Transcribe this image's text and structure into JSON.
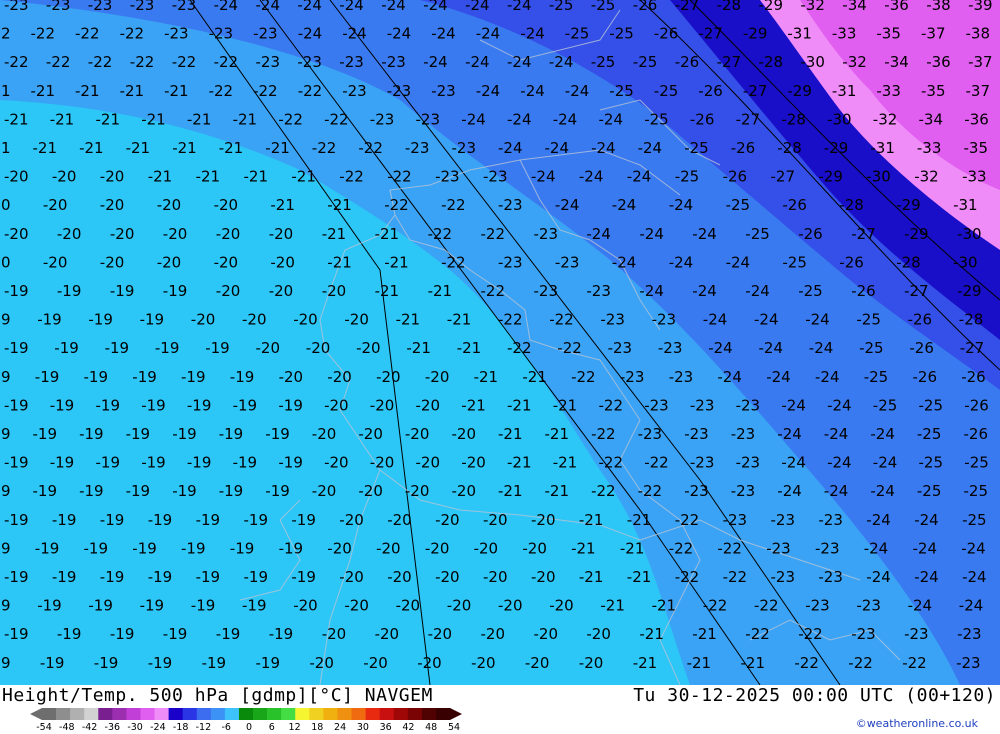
{
  "header": {
    "product_title": "Height/Temp. 500 hPa [gdmp][°C] NAVGEM",
    "valid_time": "Tu 30-12-2025 00:00 UTC (00+120)"
  },
  "legend": {
    "ticks": [
      "-54",
      "-48",
      "-42",
      "-36",
      "-30",
      "-24",
      "-18",
      "-12",
      "-6",
      "0",
      "6",
      "12",
      "18",
      "24",
      "30",
      "36",
      "42",
      "48",
      "54"
    ],
    "colors": [
      "#6e6e6e",
      "#8e8e8e",
      "#b0b0b0",
      "#d2d2d2",
      "#7a1f8f",
      "#9b2fb0",
      "#c13fd6",
      "#e05ff0",
      "#f08cf7",
      "#1a00c8",
      "#2a35e6",
      "#3c6cf0",
      "#3d93f5",
      "#3ec2fb",
      "#0a8a0a",
      "#19a619",
      "#2ac22a",
      "#44dd44",
      "#f5f532",
      "#f0d020",
      "#f0b010",
      "#f09010",
      "#f06a10",
      "#e82a10",
      "#c81010",
      "#a00808",
      "#7a0404",
      "#500202",
      "#380000"
    ]
  },
  "map": {
    "temperature_bands": [
      {
        "value": "-19",
        "color": "#2cc6f7"
      },
      {
        "value": "-20",
        "color": "#2cc6f7"
      },
      {
        "value": "-21",
        "color": "#3aa3f5"
      },
      {
        "value": "-22",
        "color": "#3aa3f5"
      },
      {
        "value": "-23",
        "color": "#3a7af0"
      },
      {
        "value": "-24",
        "color": "#3a7af0"
      },
      {
        "value": "-25",
        "color": "#3450e8"
      },
      {
        "value": "-26",
        "color": "#3450e8"
      },
      {
        "value": "-27",
        "color": "#1a0fc8"
      },
      {
        "value": "-28",
        "color": "#1a0fc8"
      },
      {
        "value": "-29",
        "color": "#1a0fc8"
      },
      {
        "value": "-30",
        "color": "#f08cf7"
      },
      {
        "value": "-31",
        "color": "#f08cf7"
      },
      {
        "value": "-32",
        "color": "#f08cf7"
      },
      {
        "value": "-33",
        "color": "#e05ff0"
      },
      {
        "value": "-34",
        "color": "#e05ff0"
      },
      {
        "value": "-35",
        "color": "#e05ff0"
      },
      {
        "value": "-36",
        "color": "#e05ff0"
      },
      {
        "value": "-37",
        "color": "#e05ff0"
      },
      {
        "value": "-38",
        "color": "#e05ff0"
      },
      {
        "value": "-39",
        "color": "#e05ff0"
      }
    ],
    "contour_labels": {
      "row_a": [
        "-23",
        "-23",
        "-23",
        "-23",
        "-23",
        "-24",
        "-24",
        "-24",
        "-24",
        "-24",
        "-24",
        "-24",
        "-24",
        "-25",
        "-25",
        "-26",
        "-27",
        "-28",
        "-29",
        "-32",
        "-34",
        "-36",
        "-38",
        "-39"
      ],
      "row_b": [
        "-22",
        "-22",
        "-22",
        "-22",
        "-23",
        "-23",
        "-23",
        "-24",
        "-24",
        "-24",
        "-24",
        "-24",
        "-24",
        "-25",
        "-25",
        "-26",
        "-27",
        "-29",
        "-31",
        "-33",
        "-35",
        "-37",
        "-38"
      ],
      "row_c": [
        "-22",
        "-22",
        "-22",
        "-22",
        "-22",
        "-22",
        "-23",
        "-23",
        "-23",
        "-23",
        "-24",
        "-24",
        "-24",
        "-24",
        "-25",
        "-25",
        "-26",
        "-27",
        "-28",
        "-30",
        "-32",
        "-34",
        "-36",
        "-37"
      ],
      "row_d": [
        "-21",
        "-21",
        "-21",
        "-21",
        "-21",
        "-22",
        "-22",
        "-22",
        "-23",
        "-23",
        "-23",
        "-24",
        "-24",
        "-24",
        "-25",
        "-25",
        "-26",
        "-27",
        "-29",
        "-31",
        "-33",
        "-35",
        "-37"
      ],
      "row_e": [
        "-21",
        "-21",
        "-21",
        "-21",
        "-21",
        "-21",
        "-22",
        "-22",
        "-23",
        "-23",
        "-24",
        "-24",
        "-24",
        "-24",
        "-25",
        "-26",
        "-27",
        "-28",
        "-30",
        "-32",
        "-34",
        "-36"
      ],
      "row_f": [
        "-21",
        "-21",
        "-21",
        "-21",
        "-21",
        "-21",
        "-21",
        "-22",
        "-22",
        "-23",
        "-23",
        "-24",
        "-24",
        "-24",
        "-24",
        "-25",
        "-26",
        "-28",
        "-29",
        "-31",
        "-33",
        "-35"
      ],
      "row_g": [
        "-20",
        "-20",
        "-20",
        "-21",
        "-21",
        "-21",
        "-21",
        "-22",
        "-22",
        "-23",
        "-23",
        "-24",
        "-24",
        "-24",
        "-25",
        "-26",
        "-27",
        "-29",
        "-30",
        "-32",
        "-33"
      ],
      "row_h": [
        "-20",
        "-20",
        "-20",
        "-20",
        "-20",
        "-21",
        "-21",
        "-22",
        "-22",
        "-23",
        "-24",
        "-24",
        "-24",
        "-25",
        "-26",
        "-28",
        "-29",
        "-31"
      ],
      "row_i": [
        "-20",
        "-20",
        "-20",
        "-20",
        "-20",
        "-20",
        "-21",
        "-21",
        "-22",
        "-22",
        "-23",
        "-24",
        "-24",
        "-24",
        "-25",
        "-26",
        "-27",
        "-29",
        "-30"
      ],
      "row_j": [
        "-20",
        "-20",
        "-20",
        "-20",
        "-20",
        "-20",
        "-21",
        "-21",
        "-22",
        "-23",
        "-23",
        "-24",
        "-24",
        "-24",
        "-25",
        "-26",
        "-28",
        "-30"
      ],
      "row_k": [
        "-19",
        "-19",
        "-19",
        "-19",
        "-20",
        "-20",
        "-20",
        "-21",
        "-21",
        "-22",
        "-23",
        "-23",
        "-24",
        "-24",
        "-24",
        "-25",
        "-26",
        "-27",
        "-29"
      ],
      "row_l": [
        "-19",
        "-19",
        "-19",
        "-19",
        "-20",
        "-20",
        "-20",
        "-20",
        "-21",
        "-21",
        "-22",
        "-22",
        "-23",
        "-23",
        "-24",
        "-24",
        "-24",
        "-25",
        "-26",
        "-28"
      ],
      "row_m": [
        "-19",
        "-19",
        "-19",
        "-19",
        "-19",
        "-20",
        "-20",
        "-20",
        "-21",
        "-21",
        "-22",
        "-22",
        "-23",
        "-23",
        "-24",
        "-24",
        "-24",
        "-25",
        "-26",
        "-27"
      ],
      "row_n": [
        "-19",
        "-19",
        "-19",
        "-19",
        "-19",
        "-19",
        "-20",
        "-20",
        "-20",
        "-20",
        "-21",
        "-21",
        "-22",
        "-23",
        "-23",
        "-24",
        "-24",
        "-24",
        "-25",
        "-26",
        "-26"
      ],
      "row_o": [
        "-19",
        "-19",
        "-19",
        "-19",
        "-19",
        "-19",
        "-19",
        "-20",
        "-20",
        "-20",
        "-21",
        "-21",
        "-21",
        "-22",
        "-23",
        "-23",
        "-23",
        "-24",
        "-24",
        "-25",
        "-25",
        "-26"
      ],
      "row_p": [
        "-19",
        "-19",
        "-19",
        "-19",
        "-19",
        "-19",
        "-19",
        "-20",
        "-20",
        "-20",
        "-20",
        "-21",
        "-21",
        "-22",
        "-23",
        "-23",
        "-23",
        "-24",
        "-24",
        "-24",
        "-25",
        "-26"
      ],
      "row_q": [
        "-19",
        "-19",
        "-19",
        "-19",
        "-19",
        "-19",
        "-19",
        "-20",
        "-20",
        "-20",
        "-20",
        "-21",
        "-21",
        "-22",
        "-22",
        "-23",
        "-23",
        "-24",
        "-24",
        "-24",
        "-25",
        "-25"
      ],
      "row_r": [
        "-19",
        "-19",
        "-19",
        "-19",
        "-19",
        "-19",
        "-19",
        "-20",
        "-20",
        "-20",
        "-20",
        "-21",
        "-21",
        "-22",
        "-22",
        "-23",
        "-23",
        "-24",
        "-24",
        "-24",
        "-25",
        "-25"
      ],
      "row_s": [
        "-19",
        "-19",
        "-19",
        "-19",
        "-19",
        "-19",
        "-19",
        "-20",
        "-20",
        "-20",
        "-20",
        "-20",
        "-21",
        "-21",
        "-22",
        "-23",
        "-23",
        "-23",
        "-24",
        "-24",
        "-25"
      ],
      "row_t": [
        "-19",
        "-19",
        "-19",
        "-19",
        "-19",
        "-19",
        "-19",
        "-20",
        "-20",
        "-20",
        "-20",
        "-20",
        "-21",
        "-21",
        "-22",
        "-22",
        "-23",
        "-23",
        "-24",
        "-24",
        "-24"
      ],
      "row_u": [
        "-19",
        "-19",
        "-19",
        "-19",
        "-19",
        "-19",
        "-19",
        "-20",
        "-20",
        "-20",
        "-20",
        "-20",
        "-21",
        "-21",
        "-22",
        "-22",
        "-23",
        "-23",
        "-24",
        "-24",
        "-24"
      ],
      "row_v": [
        "-19",
        "-19",
        "-19",
        "-19",
        "-19",
        "-19",
        "-20",
        "-20",
        "-20",
        "-20",
        "-20",
        "-20",
        "-21",
        "-21",
        "-22",
        "-22",
        "-23",
        "-23",
        "-24",
        "-24"
      ],
      "row_w": [
        "-19",
        "-19",
        "-19",
        "-19",
        "-19",
        "-19",
        "-20",
        "-20",
        "-20",
        "-20",
        "-20",
        "-20",
        "-21",
        "-21",
        "-22",
        "-22",
        "-23",
        "-23",
        "-23"
      ],
      "row_x": [
        "-19",
        "-19",
        "-19",
        "-19",
        "-19",
        "-19",
        "-20",
        "-20",
        "-20",
        "-20",
        "-20",
        "-20",
        "-21",
        "-21",
        "-21",
        "-22",
        "-22",
        "-22",
        "-23"
      ]
    }
  },
  "credit": "©weatheronline.co.uk"
}
